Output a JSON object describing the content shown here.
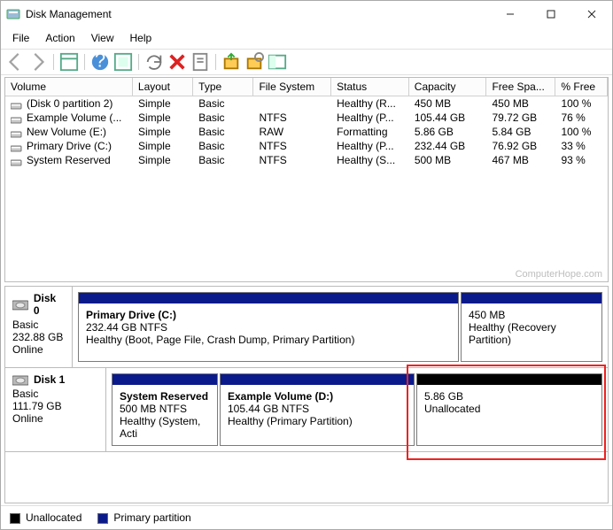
{
  "window": {
    "title": "Disk Management"
  },
  "menu": {
    "file": "File",
    "action": "Action",
    "view": "View",
    "help": "Help"
  },
  "columns": [
    "Volume",
    "Layout",
    "Type",
    "File System",
    "Status",
    "Capacity",
    "Free Spa...",
    "% Free"
  ],
  "volumes": [
    {
      "name": "(Disk 0 partition 2)",
      "layout": "Simple",
      "type": "Basic",
      "fs": "",
      "status": "Healthy (R...",
      "cap": "450 MB",
      "free": "450 MB",
      "pct": "100 %"
    },
    {
      "name": "Example Volume (...",
      "layout": "Simple",
      "type": "Basic",
      "fs": "NTFS",
      "status": "Healthy (P...",
      "cap": "105.44 GB",
      "free": "79.72 GB",
      "pct": "76 %"
    },
    {
      "name": "New Volume (E:)",
      "layout": "Simple",
      "type": "Basic",
      "fs": "RAW",
      "status": "Formatting",
      "cap": "5.86 GB",
      "free": "5.84 GB",
      "pct": "100 %"
    },
    {
      "name": "Primary Drive (C:)",
      "layout": "Simple",
      "type": "Basic",
      "fs": "NTFS",
      "status": "Healthy (P...",
      "cap": "232.44 GB",
      "free": "76.92 GB",
      "pct": "33 %"
    },
    {
      "name": "System Reserved",
      "layout": "Simple",
      "type": "Basic",
      "fs": "NTFS",
      "status": "Healthy (S...",
      "cap": "500 MB",
      "free": "467 MB",
      "pct": "93 %"
    }
  ],
  "watermark": "ComputerHope.com",
  "disks": [
    {
      "label": "Disk 0",
      "type": "Basic",
      "size": "232.88 GB",
      "state": "Online",
      "parts": [
        {
          "title": "Primary Drive  (C:)",
          "line1": "232.44 GB NTFS",
          "line2": "Healthy (Boot, Page File, Crash Dump, Primary Partition)",
          "bar": "blue",
          "flex": "430"
        },
        {
          "title": "",
          "line1": "450 MB",
          "line2": "Healthy (Recovery Partition)",
          "bar": "blue",
          "flex": "160"
        }
      ]
    },
    {
      "label": "Disk 1",
      "type": "Basic",
      "size": "111.79 GB",
      "state": "Online",
      "parts": [
        {
          "title": "System Reserved",
          "line1": "500 MB NTFS",
          "line2": "Healthy (System, Acti",
          "bar": "blue",
          "flex": "120"
        },
        {
          "title": "Example Volume  (D:)",
          "line1": "105.44 GB NTFS",
          "line2": "Healthy (Primary Partition)",
          "bar": "blue",
          "flex": "220"
        },
        {
          "title": "",
          "line1": "5.86 GB",
          "line2": "Unallocated",
          "bar": "black",
          "flex": "210"
        }
      ]
    }
  ],
  "legend": {
    "unallocated": "Unallocated",
    "primary": "Primary partition"
  }
}
